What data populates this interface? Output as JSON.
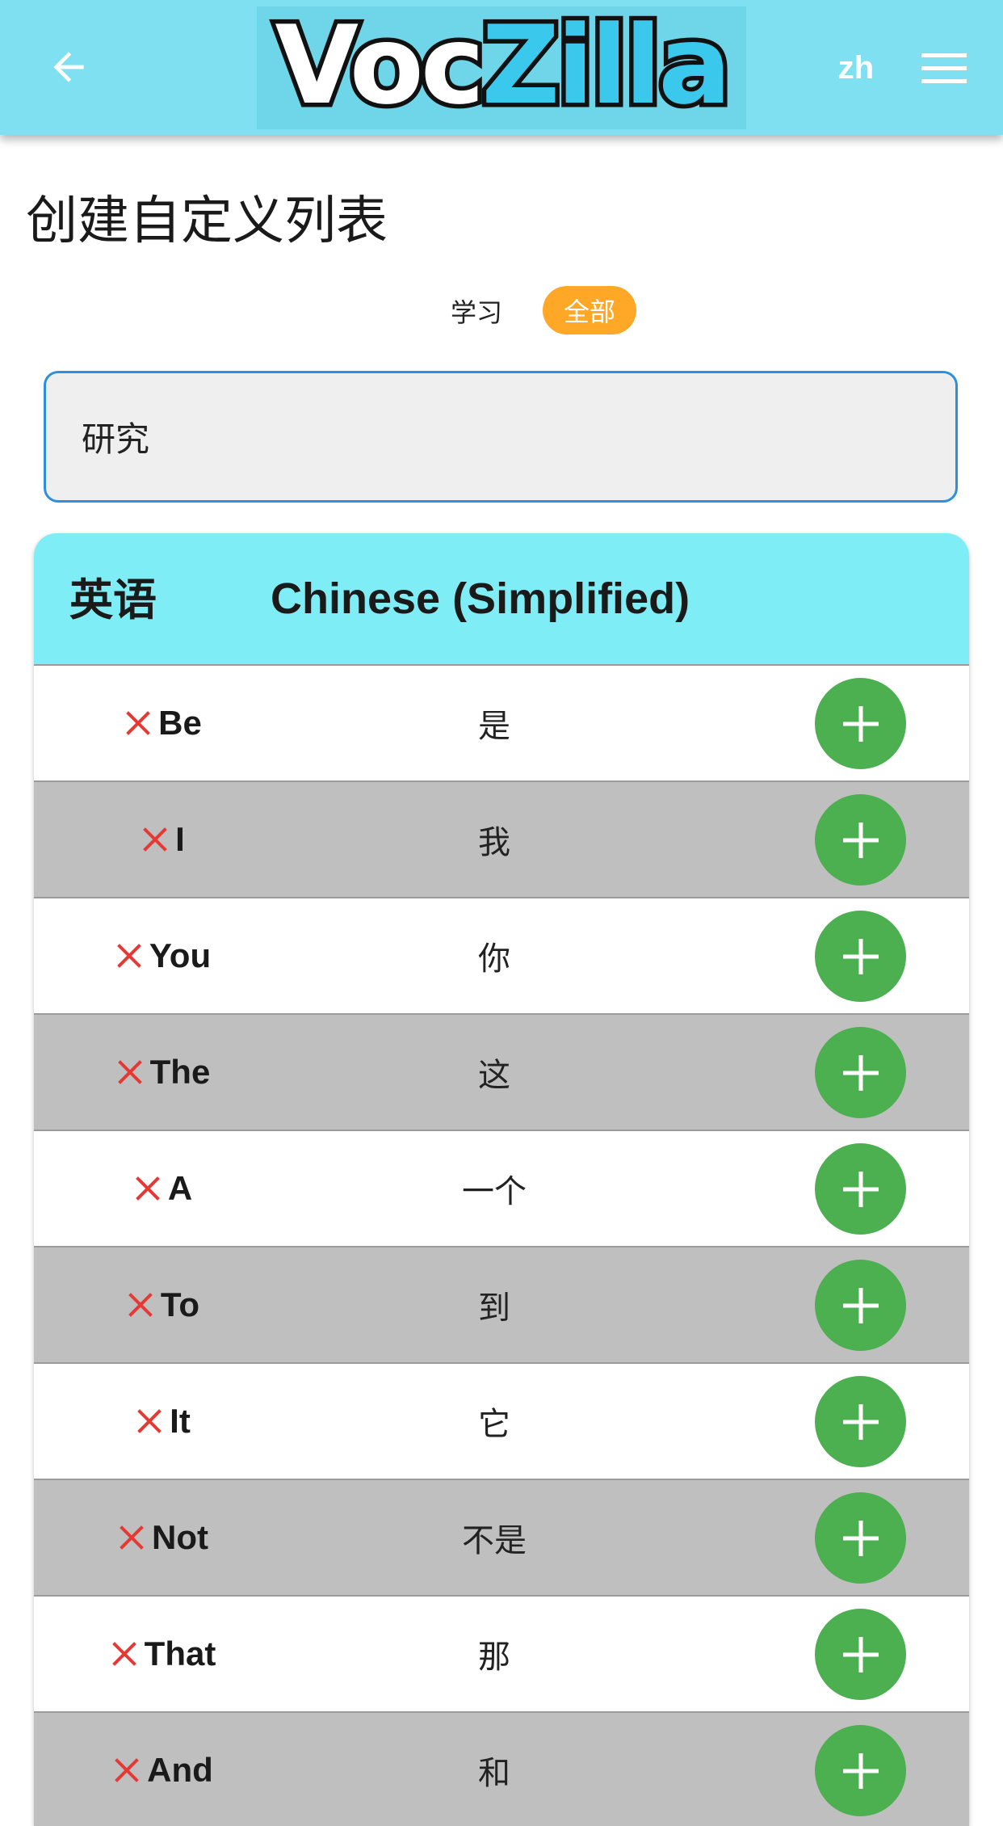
{
  "appbar": {
    "logo_part1": "Voc",
    "logo_part2": "Zilla",
    "lang_label": "zh",
    "icons": [
      "arrow-left-icon",
      "hamburger-menu-icon"
    ]
  },
  "page": {
    "title": "创建自定义列表"
  },
  "filters": {
    "learn_label": "学习",
    "all_label": "全部",
    "active": "all"
  },
  "search": {
    "value": "研究"
  },
  "table": {
    "header_source": "英语",
    "header_target": "Chinese (Simplified)",
    "rows": [
      {
        "en": "Be",
        "zh": "是"
      },
      {
        "en": "I",
        "zh": "我"
      },
      {
        "en": "You",
        "zh": "你"
      },
      {
        "en": "The",
        "zh": "这"
      },
      {
        "en": "A",
        "zh": "一个"
      },
      {
        "en": "To",
        "zh": "到"
      },
      {
        "en": "It",
        "zh": "它"
      },
      {
        "en": "Not",
        "zh": "不是"
      },
      {
        "en": "That",
        "zh": "那"
      },
      {
        "en": "And",
        "zh": "和"
      }
    ]
  },
  "colors": {
    "appbar_bg": "#7ee0f0",
    "header_bg": "#7fedf5",
    "accent_orange": "#ffa726",
    "add_green": "#4caf50",
    "delete_red": "#e53935",
    "input_border": "#2f8fdc",
    "row_alt": "#bfbfbf"
  }
}
